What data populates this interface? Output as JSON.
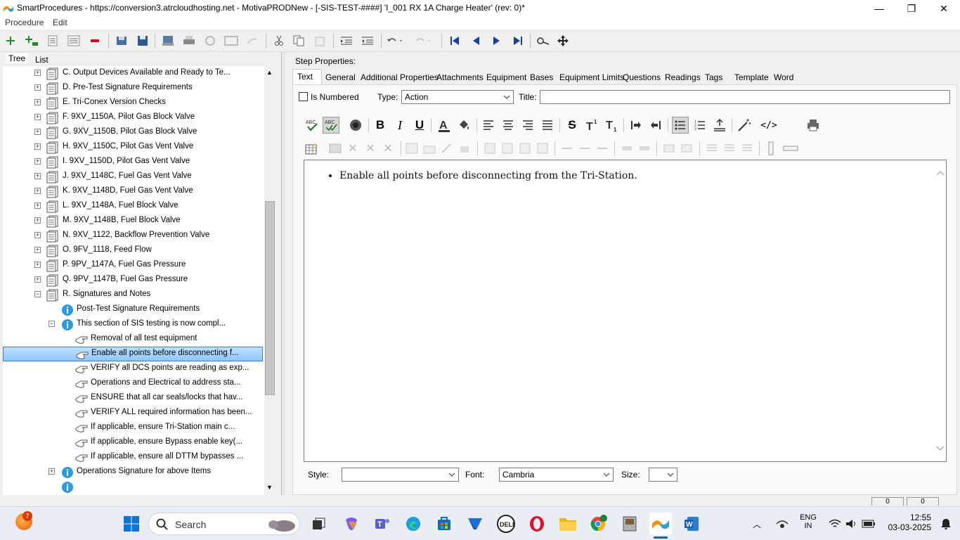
{
  "window": {
    "title": "SmartProcedures - https://conversion3.atrcloudhosting.net - MotivaPRODNew - [-SIS-TEST-####] 'I_001 RX 1A Charge Heater' (rev: 0)*",
    "minimize": "—",
    "maximize": "❐",
    "close": "✕"
  },
  "menu": {
    "procedure": "Procedure",
    "edit": "Edit"
  },
  "left_tabs": {
    "tree": "Tree",
    "list": "List"
  },
  "tree": {
    "items": [
      {
        "label": "C. Output Devices Available and Ready to Te..."
      },
      {
        "label": "D. Pre-Test Signature Requirements"
      },
      {
        "label": "E. Tri-Conex Version Checks"
      },
      {
        "label": "F. 9XV_1150A, Pilot Gas Block Valve"
      },
      {
        "label": "G. 9XV_1150B, Pilot Gas Block Valve"
      },
      {
        "label": "H. 9XV_1150C, Pilot Gas Vent Valve"
      },
      {
        "label": "I. 9XV_1150D, Pilot Gas Vent Valve"
      },
      {
        "label": "J. 9XV_1148C, Fuel Gas Vent Valve"
      },
      {
        "label": "K. 9XV_1148D, Fuel Gas Vent Valve"
      },
      {
        "label": "L. 9XV_1148A, Fuel Block Valve"
      },
      {
        "label": "M. 9XV_1148B, Fuel Block Valve"
      },
      {
        "label": "N. 9XV_1122, Backflow Prevention Valve"
      },
      {
        "label": "O. 9FV_1118, Feed Flow"
      },
      {
        "label": "P. 9PV_1147A, Fuel Gas Pressure"
      },
      {
        "label": "Q. 9PV_1147B, Fuel Gas Pressure"
      },
      {
        "label": "R. Signatures and Notes"
      },
      {
        "label": "Post-Test Signature Requirements"
      },
      {
        "label": "This section of SIS testing is now compl..."
      },
      {
        "label": "Removal of all test equipment"
      },
      {
        "label": "Enable all points before disconnecting f..."
      },
      {
        "label": "VERIFY all DCS points are reading as exp..."
      },
      {
        "label": "Operations and Electrical to address sta..."
      },
      {
        "label": "ENSURE that all car seals/locks that hav..."
      },
      {
        "label": "VERIFY ALL required information has been..."
      },
      {
        "label": "If applicable, ensure Tri-Station main c..."
      },
      {
        "label": "If applicable, ensure Bypass enable key(..."
      },
      {
        "label": "If applicable, ensure all DTTM bypasses ..."
      },
      {
        "label": "Operations Signature for above Items"
      },
      {
        "label": ""
      }
    ]
  },
  "step_properties": {
    "heading": "Step Properties:",
    "tabs": [
      "Text",
      "General",
      "Additional Properties",
      "Attachments",
      "Equipment",
      "Bases",
      "Equipment Limits",
      "Questions",
      "Readings",
      "Tags",
      "Template",
      "Word"
    ],
    "is_numbered": "Is Numbered",
    "type_label": "Type:",
    "type_value": "Action",
    "title_label": "Title:",
    "title_value": ""
  },
  "editor": {
    "bullet_text": "Enable all points before disconnecting from the Tri-Station."
  },
  "bottom": {
    "style_label": "Style:",
    "style_value": "",
    "font_label": "Font:",
    "font_value": "Cambria",
    "size_label": "Size:",
    "size_value": "",
    "status_a": "0",
    "status_b": "0"
  },
  "taskbar": {
    "search": "Search",
    "lang_top": "ENG",
    "lang_bottom": "IN",
    "time": "12:55",
    "date": "03-03-2025",
    "notif_badge": "7"
  },
  "colors": {
    "selection": "#8fc7ff",
    "accent": "#0067c0",
    "info_icon": "#2b9be6"
  }
}
